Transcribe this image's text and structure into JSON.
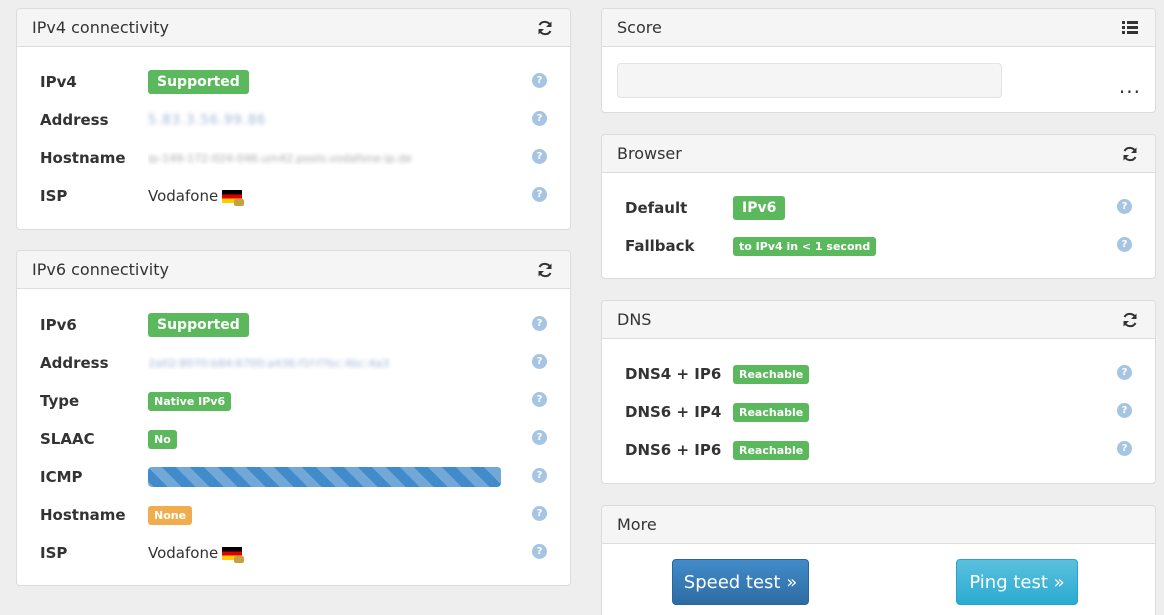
{
  "ipv4": {
    "title": "IPv4 connectivity",
    "rows": [
      {
        "label": "IPv4",
        "value": "Supported"
      },
      {
        "label": "Address",
        "value": "5.83.3.56.99.86"
      },
      {
        "label": "Hostname",
        "value": "ip-149-172-024-046.um42.pools.vodafone-ip.de"
      },
      {
        "label": "ISP",
        "value": "Vodafone"
      }
    ]
  },
  "ipv6": {
    "title": "IPv6 connectivity",
    "rows": [
      {
        "label": "IPv6",
        "value": "Supported"
      },
      {
        "label": "Address",
        "value": "2a02:8070:b84:6700:a436:f1f:f7bc:4bc:4a3"
      },
      {
        "label": "Type",
        "value": "Native IPv6"
      },
      {
        "label": "SLAAC",
        "value": "No"
      },
      {
        "label": "ICMP",
        "value": ""
      },
      {
        "label": "Hostname",
        "value": "None"
      },
      {
        "label": "ISP",
        "value": "Vodafone"
      }
    ],
    "icmp_progress": 1.0
  },
  "score": {
    "title": "Score",
    "more": "..."
  },
  "browser": {
    "title": "Browser",
    "rows": [
      {
        "label": "Default",
        "value": "IPv6"
      },
      {
        "label": "Fallback",
        "value": "to IPv4 in < 1 second"
      }
    ]
  },
  "dns": {
    "title": "DNS",
    "rows": [
      {
        "label": "DNS4 + IP6",
        "value": "Reachable"
      },
      {
        "label": "DNS6 + IP4",
        "value": "Reachable"
      },
      {
        "label": "DNS6 + IP6",
        "value": "Reachable"
      }
    ]
  },
  "more": {
    "title": "More",
    "speed_label": "Speed test »",
    "ping_label": "Ping test »"
  },
  "help_glyph": "?",
  "colors": {
    "success": "#5cb85c",
    "warning": "#f0ad4e",
    "primary": "#428bca",
    "info": "#5bc0de",
    "help": "#a6c5e2"
  },
  "icons": {
    "refresh": "refresh-icon",
    "list": "list-icon",
    "flag": "germany-flag-icon"
  }
}
